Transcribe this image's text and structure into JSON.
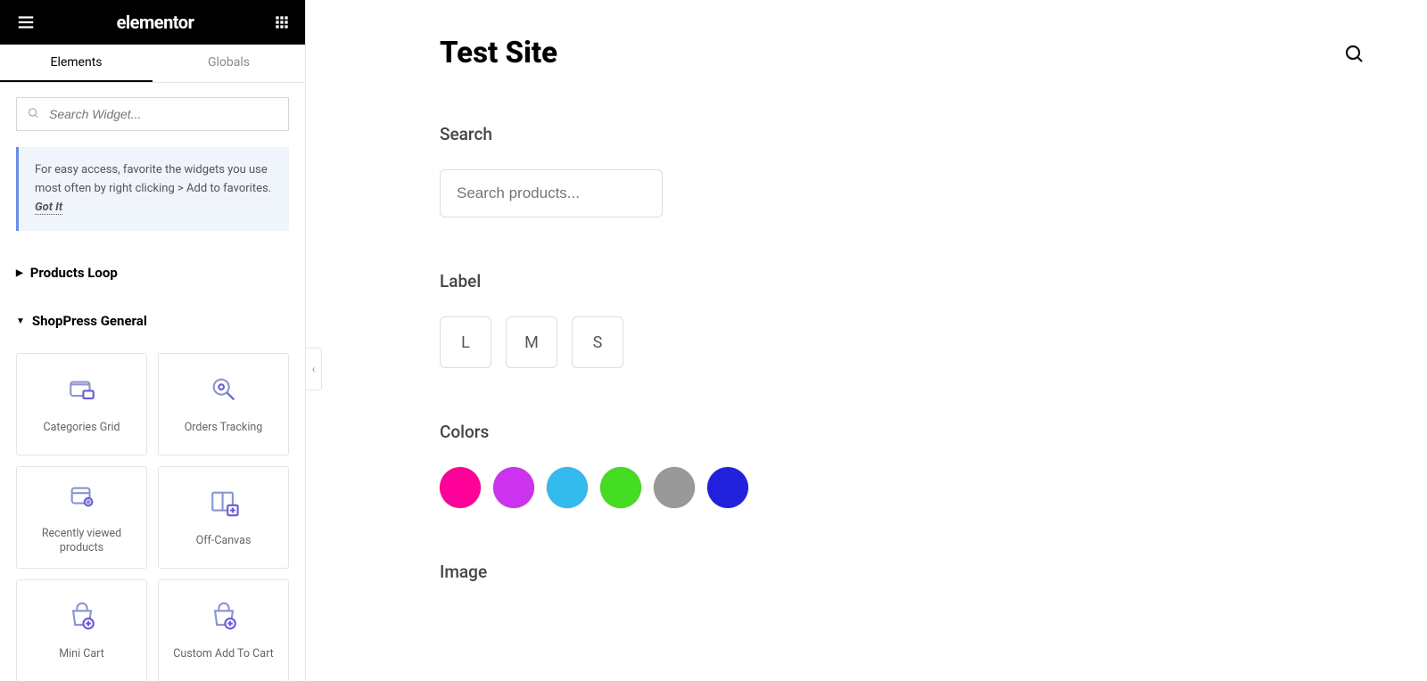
{
  "sidebar": {
    "logo": "elementor",
    "tabs": {
      "elements": "Elements",
      "globals": "Globals"
    },
    "search_placeholder": "Search Widget...",
    "tip": {
      "text": "For easy access, favorite the widgets you use most often by right clicking > Add to favorites.",
      "got_it": "Got It"
    },
    "categories": [
      {
        "name": "Products Loop",
        "expanded": false
      },
      {
        "name": "ShopPress General",
        "expanded": true,
        "widgets": [
          {
            "label": "Categories Grid",
            "icon": "folder"
          },
          {
            "label": "Orders Tracking",
            "icon": "map-pin-search"
          },
          {
            "label": "Recently viewed products",
            "icon": "box-eye"
          },
          {
            "label": "Off-Canvas",
            "icon": "panel-plus"
          },
          {
            "label": "Mini Cart",
            "icon": "bag-plus"
          },
          {
            "label": "Custom Add To Cart",
            "icon": "bag-plus"
          }
        ]
      }
    ]
  },
  "canvas": {
    "site_title": "Test Site",
    "sections": {
      "search": {
        "title": "Search",
        "placeholder": "Search products..."
      },
      "label": {
        "title": "Label",
        "options": [
          "L",
          "M",
          "S"
        ]
      },
      "colors": {
        "title": "Colors",
        "swatches": [
          "#ff0099",
          "#cc33ee",
          "#33bbee",
          "#44dd22",
          "#999999",
          "#2222dd"
        ]
      },
      "image": {
        "title": "Image"
      }
    }
  }
}
